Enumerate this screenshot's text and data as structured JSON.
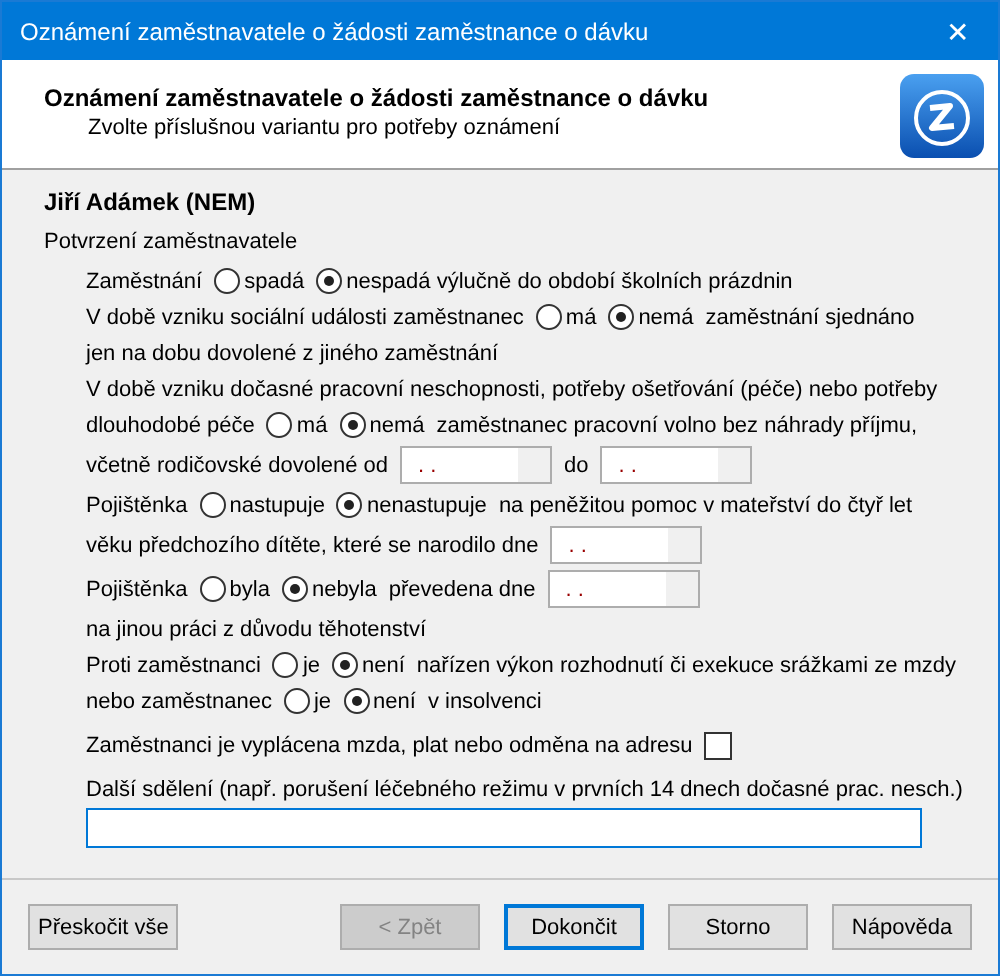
{
  "window": {
    "title": "Oznámení zaměstnavatele o žádosti zaměstnance o dávku",
    "close": "✕"
  },
  "header": {
    "heading": "Oznámení zaměstnavatele o žádosti zaměstnance o dávku",
    "subheading": "Zvolte příslušnou variantu pro potřeby oznámení"
  },
  "person": "Jiří Adámek (NEM)",
  "section_label": "Potvrzení zaměstnavatele",
  "lines": [
    {
      "items": [
        {
          "kind": "text",
          "text": "Zaměstnání"
        },
        {
          "kind": "radio",
          "label": "spadá",
          "selected": false
        },
        {
          "kind": "radio",
          "label": "nespadá výlučně do období školních prázdnin",
          "selected": true
        }
      ]
    },
    {
      "items": [
        {
          "kind": "text",
          "text": "V době vzniku sociální události zaměstnanec"
        },
        {
          "kind": "radio",
          "label": "má",
          "selected": false
        },
        {
          "kind": "radio",
          "label": "nemá",
          "selected": true
        },
        {
          "kind": "text",
          "text": "zaměstnání sjednáno"
        }
      ]
    },
    {
      "items": [
        {
          "kind": "text",
          "text": "jen na dobu dovolené z jiného zaměstnání"
        }
      ]
    },
    {
      "items": [
        {
          "kind": "text",
          "text": "V době vzniku dočasné pracovní neschopnosti, potřeby ošetřování (péče) nebo potřeby"
        }
      ]
    },
    {
      "items": [
        {
          "kind": "text",
          "text": "dlouhodobé péče"
        },
        {
          "kind": "radio",
          "label": "má",
          "selected": false
        },
        {
          "kind": "radio",
          "label": "nemá",
          "selected": true
        },
        {
          "kind": "text",
          "text": "zaměstnanec pracovní volno bez náhrady příjmu,"
        }
      ]
    },
    {
      "items": [
        {
          "kind": "text",
          "text": "včetně rodičovské dovolené od"
        },
        {
          "kind": "date",
          "value": ". ."
        },
        {
          "kind": "text",
          "text": "do"
        },
        {
          "kind": "date",
          "value": ". ."
        }
      ]
    },
    {
      "items": [
        {
          "kind": "text",
          "text": "Pojištěnka"
        },
        {
          "kind": "radio",
          "label": "nastupuje",
          "selected": false
        },
        {
          "kind": "radio",
          "label": "nenastupuje",
          "selected": true
        },
        {
          "kind": "text",
          "text": "na peněžitou pomoc v mateřství do čtyř let"
        }
      ]
    },
    {
      "items": [
        {
          "kind": "text",
          "text": "věku předchozího dítěte, které se narodilo dne"
        },
        {
          "kind": "date",
          "value": ". ."
        }
      ]
    },
    {
      "items": [
        {
          "kind": "text",
          "text": "Pojištěnka"
        },
        {
          "kind": "radio",
          "label": "byla",
          "selected": false
        },
        {
          "kind": "radio",
          "label": "nebyla",
          "selected": true
        },
        {
          "kind": "text",
          "text": "převedena dne"
        },
        {
          "kind": "date",
          "value": ". ."
        }
      ]
    },
    {
      "items": [
        {
          "kind": "text",
          "text": "na jinou práci z důvodu těhotenství"
        }
      ]
    },
    {
      "items": [
        {
          "kind": "text",
          "text": "Proti zaměstnanci"
        },
        {
          "kind": "radio",
          "label": "je",
          "selected": false
        },
        {
          "kind": "radio",
          "label": "není",
          "selected": true
        },
        {
          "kind": "text",
          "text": "nařízen výkon rozhodnutí či exekuce srážkami ze mzdy"
        }
      ]
    },
    {
      "items": [
        {
          "kind": "text",
          "text": "nebo zaměstnanec"
        },
        {
          "kind": "radio",
          "label": "je",
          "selected": false
        },
        {
          "kind": "radio",
          "label": "není",
          "selected": true
        },
        {
          "kind": "text",
          "text": "v insolvenci"
        }
      ]
    },
    {
      "items": [
        {
          "kind": "text",
          "text": "Zaměstnanci je vyplácena mzda, plat nebo odměna na adresu"
        },
        {
          "kind": "checkbox",
          "checked": false
        }
      ]
    },
    {
      "items": [
        {
          "kind": "text",
          "text": "Další sdělení (např. porušení léčebného režimu v prvních 14 dnech dočasné prac. nesch.)"
        }
      ]
    },
    {
      "items": [
        {
          "kind": "input",
          "value": ""
        }
      ]
    }
  ],
  "skip_button": {
    "label": "Přeskočit vše",
    "disabled": false,
    "default": false
  },
  "buttons": [
    {
      "label": "< Zpět",
      "disabled": true,
      "default": false
    },
    {
      "label": "Dokončit",
      "disabled": false,
      "default": true
    },
    {
      "label": "Storno",
      "disabled": false,
      "default": false
    },
    {
      "label": "Nápověda",
      "disabled": false,
      "default": false
    }
  ]
}
